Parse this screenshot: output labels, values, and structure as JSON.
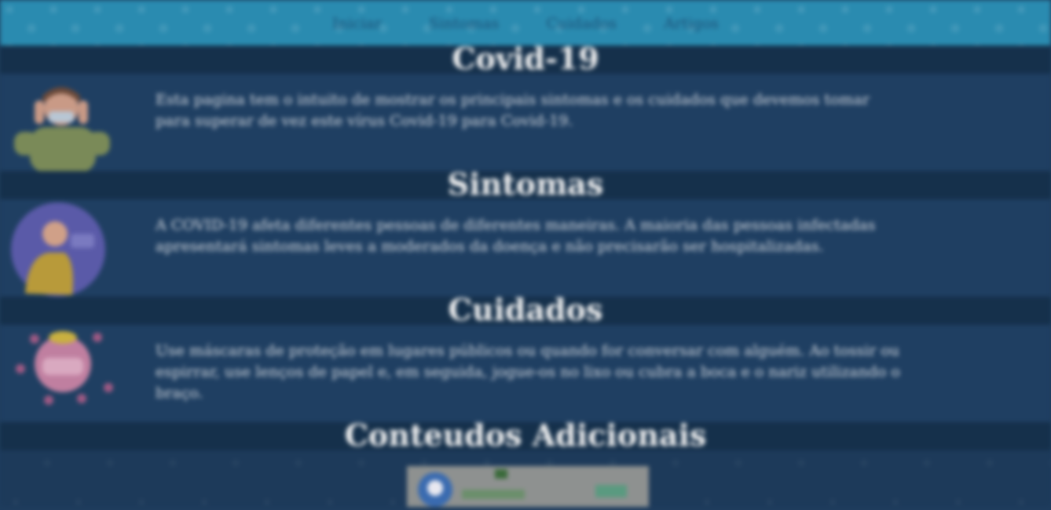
{
  "nav": {
    "links": [
      "Iniciar",
      "Sintomas",
      "Cuidados",
      "Artigos"
    ]
  },
  "sections": [
    {
      "title": "Covid-19",
      "text": "Esta pagina tem o intuito de mostrar os principais sintomas e os cuidados que devemos tomar para superar de vez este vírus Covid-19 para Covid-19."
    },
    {
      "title": "Sintomas",
      "text": "A COVID-19 afeta diferentes pessoas de diferentes maneiras. A maioria das pessoas infectadas apresentará sintomas leves a moderados da doença e não precisarão ser hospitalizadas."
    },
    {
      "title": "Cuidados",
      "text": "Use máscaras de proteção em lugares públicos ou quando for conversar com alguém. Ao tossir ou espirrar, use lenços de papel e, em seguida, jogue-os no lixo ou cubra a boca e o nariz utilizando o braço."
    }
  ],
  "extra": {
    "title": "Conteudos Adicionais"
  },
  "colors": {
    "navbar": "#2a8bb0",
    "background": "#1f3d5e",
    "band": "#15304b"
  }
}
